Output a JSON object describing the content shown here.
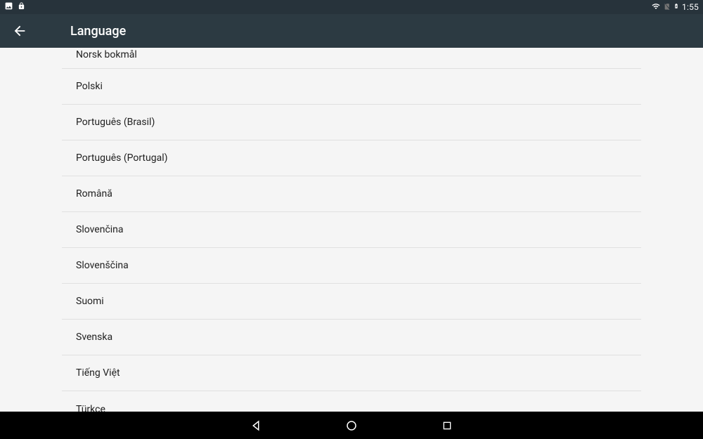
{
  "statusBar": {
    "time": "1:55"
  },
  "appBar": {
    "title": "Language"
  },
  "languages": [
    "Norsk bokmål",
    "Polski",
    "Português (Brasil)",
    "Português (Portugal)",
    "Română",
    "Slovenčina",
    "Slovenščina",
    "Suomi",
    "Svenska",
    "Tiếng Việt",
    "Türkçe"
  ]
}
